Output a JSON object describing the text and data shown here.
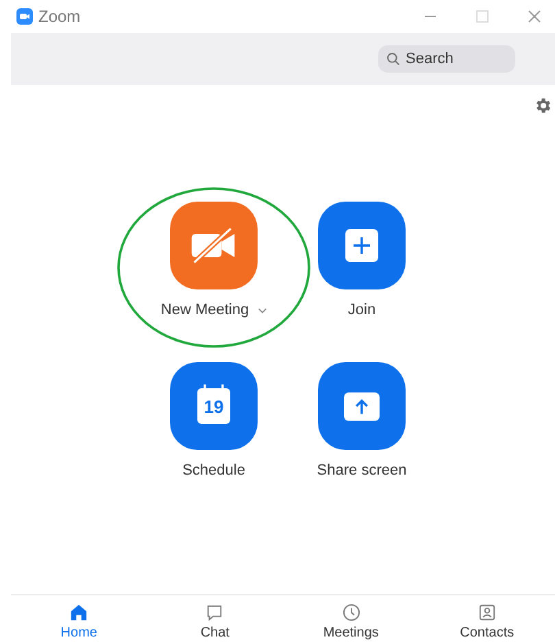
{
  "window": {
    "title": "Zoom"
  },
  "search": {
    "placeholder": "Search"
  },
  "actions": [
    {
      "kind": "video-off",
      "label": "New Meeting",
      "color": "#f26d21",
      "dropdown": true,
      "highlighted": true
    },
    {
      "kind": "plus",
      "label": "Join",
      "color": "#0e71eb",
      "dropdown": false,
      "highlighted": false
    },
    {
      "kind": "calendar",
      "label": "Schedule",
      "color": "#0e71eb",
      "dropdown": false,
      "highlighted": false,
      "day": "19"
    },
    {
      "kind": "upload",
      "label": "Share screen",
      "color": "#0e71eb",
      "dropdown": false,
      "highlighted": false
    }
  ],
  "tabs": [
    {
      "kind": "home",
      "label": "Home",
      "selected": true
    },
    {
      "kind": "chat",
      "label": "Chat",
      "selected": false
    },
    {
      "kind": "clock",
      "label": "Meetings",
      "selected": false
    },
    {
      "kind": "contact",
      "label": "Contacts",
      "selected": false
    }
  ]
}
